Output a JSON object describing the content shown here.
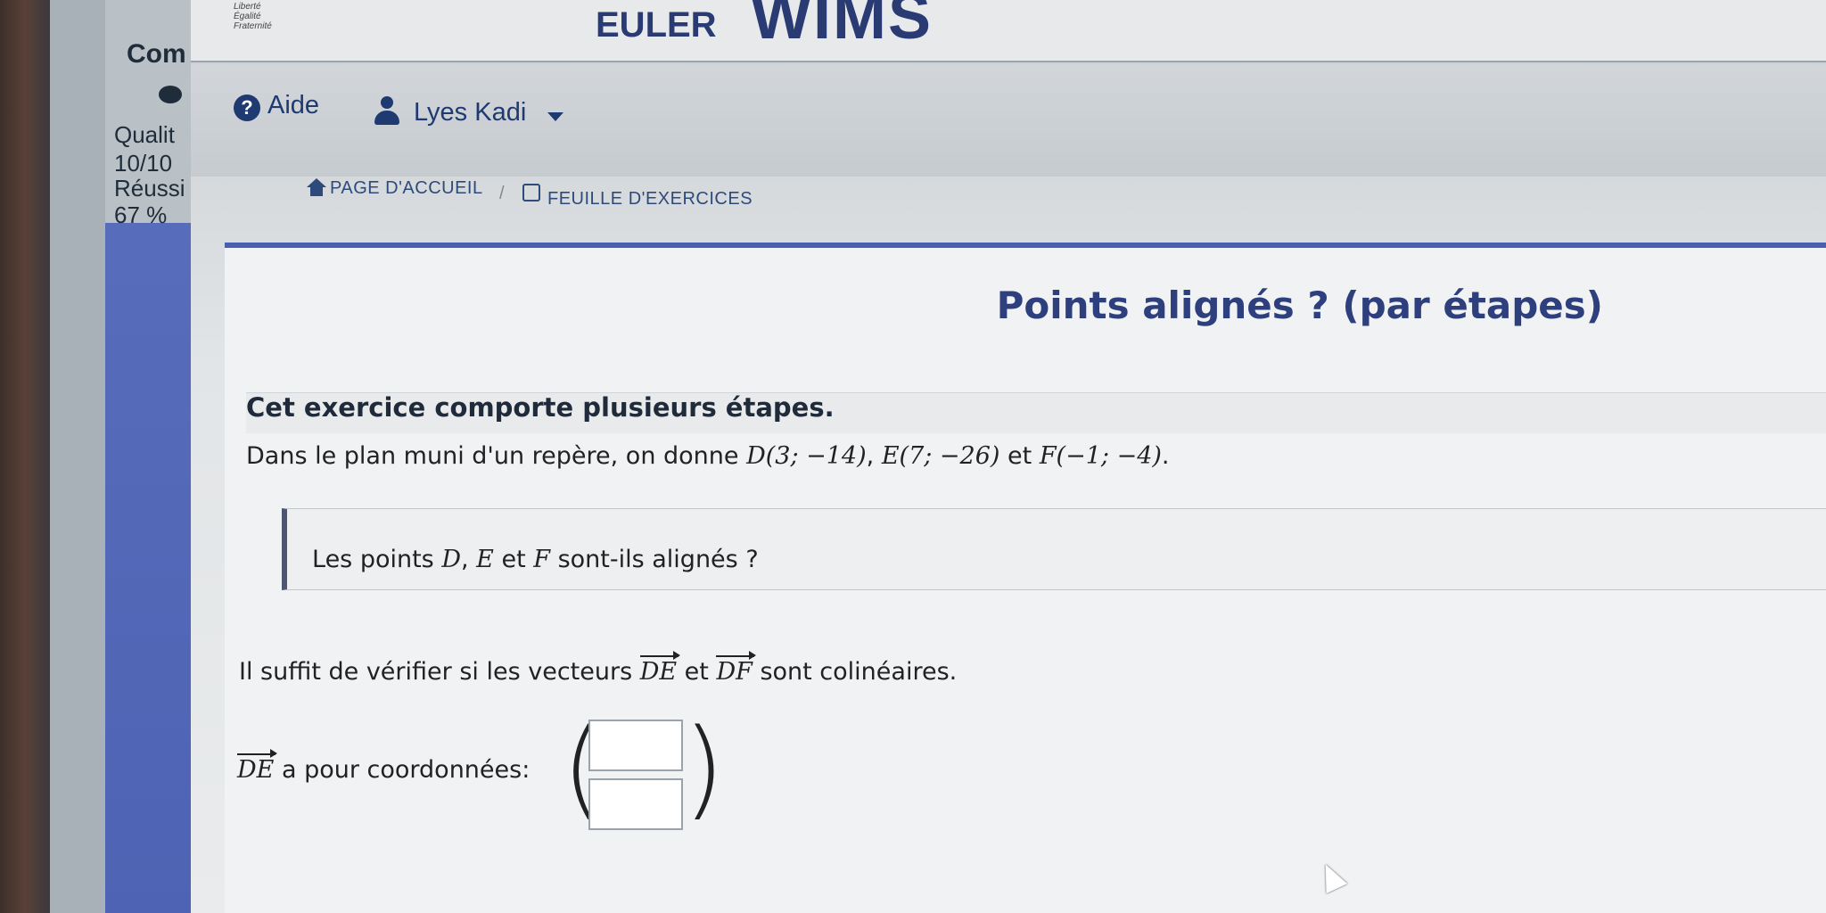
{
  "header": {
    "republic_line1": "Liberté",
    "republic_line2": "Égalité",
    "republic_line3": "Fraternité",
    "euler": "EULER",
    "wims": "WIMS"
  },
  "sidebar": {
    "truncated": "Com",
    "quality_label": "Qualit",
    "quality_value": "10/10",
    "success_label": "Réussi",
    "success_value": "67 %"
  },
  "topbar": {
    "help": "Aide",
    "user": "Lyes Kadi"
  },
  "breadcrumb": {
    "home": "PAGE D'ACCUEIL",
    "sep": "/",
    "sheet": "FEUILLE D'EXERCICES"
  },
  "exercise": {
    "title": "Points alignés ? (par étapes)",
    "intro": "Cet exercice comporte plusieurs étapes.",
    "statement_prefix": "Dans le plan muni d'un repère, on donne ",
    "point_d": "D(3; −14)",
    "point_e": "E(7; −26)",
    "conj": " et ",
    "point_f": "F(−1; −4)",
    "question_prefix": "Les points ",
    "pt_D": "D",
    "pt_E": "E",
    "pt_F": "F",
    "question_suffix": " sont-ils alignés ?",
    "hint_prefix": "Il suffit de vérifier si les vecteurs ",
    "vec_de": "DE",
    "vec_df": "DF",
    "hint_suffix": " sont colinéaires.",
    "coord_label": " a pour coordonnées:"
  }
}
